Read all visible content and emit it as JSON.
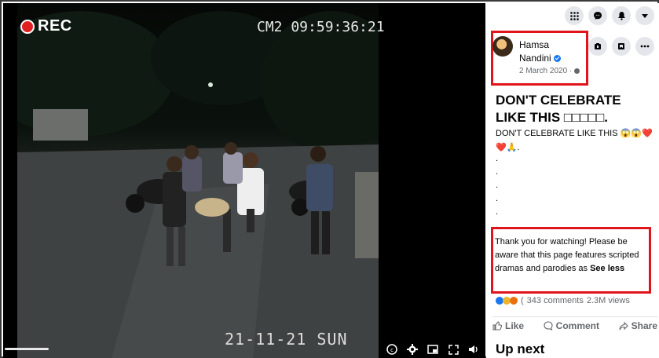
{
  "video": {
    "rec_label": "REC",
    "camera_stamp": "CM2 09:59:36:21",
    "date_stamp": "21-11-21 SUN"
  },
  "topbar": {
    "icons": [
      "grid-icon",
      "messenger-icon",
      "bell-icon",
      "chevron-down-icon"
    ]
  },
  "post": {
    "author": "Hamsa Nandini",
    "date": "2 March 2020",
    "title": "DON'T CELEBRATE LIKE THIS □□□□□.",
    "body_line": "DON'T CELEBRATE LIKE THIS 😱😱❤️❤️🙏.",
    "dots": ".\n.\n.\n.\n.\n.",
    "disclaimer": "Thank you for watching! Please be aware that this page features scripted dramas and parodies as",
    "see_less": "See less",
    "reaction_count": "(",
    "comments": "343 comments",
    "views": "2.3M views"
  },
  "actions": {
    "like": "Like",
    "comment": "Comment",
    "share": "Share"
  },
  "up_next": "Up next",
  "colors": {
    "highlight_red": "#e0141b",
    "facebook_blue": "#1877f2",
    "rec_red": "#e02020"
  }
}
